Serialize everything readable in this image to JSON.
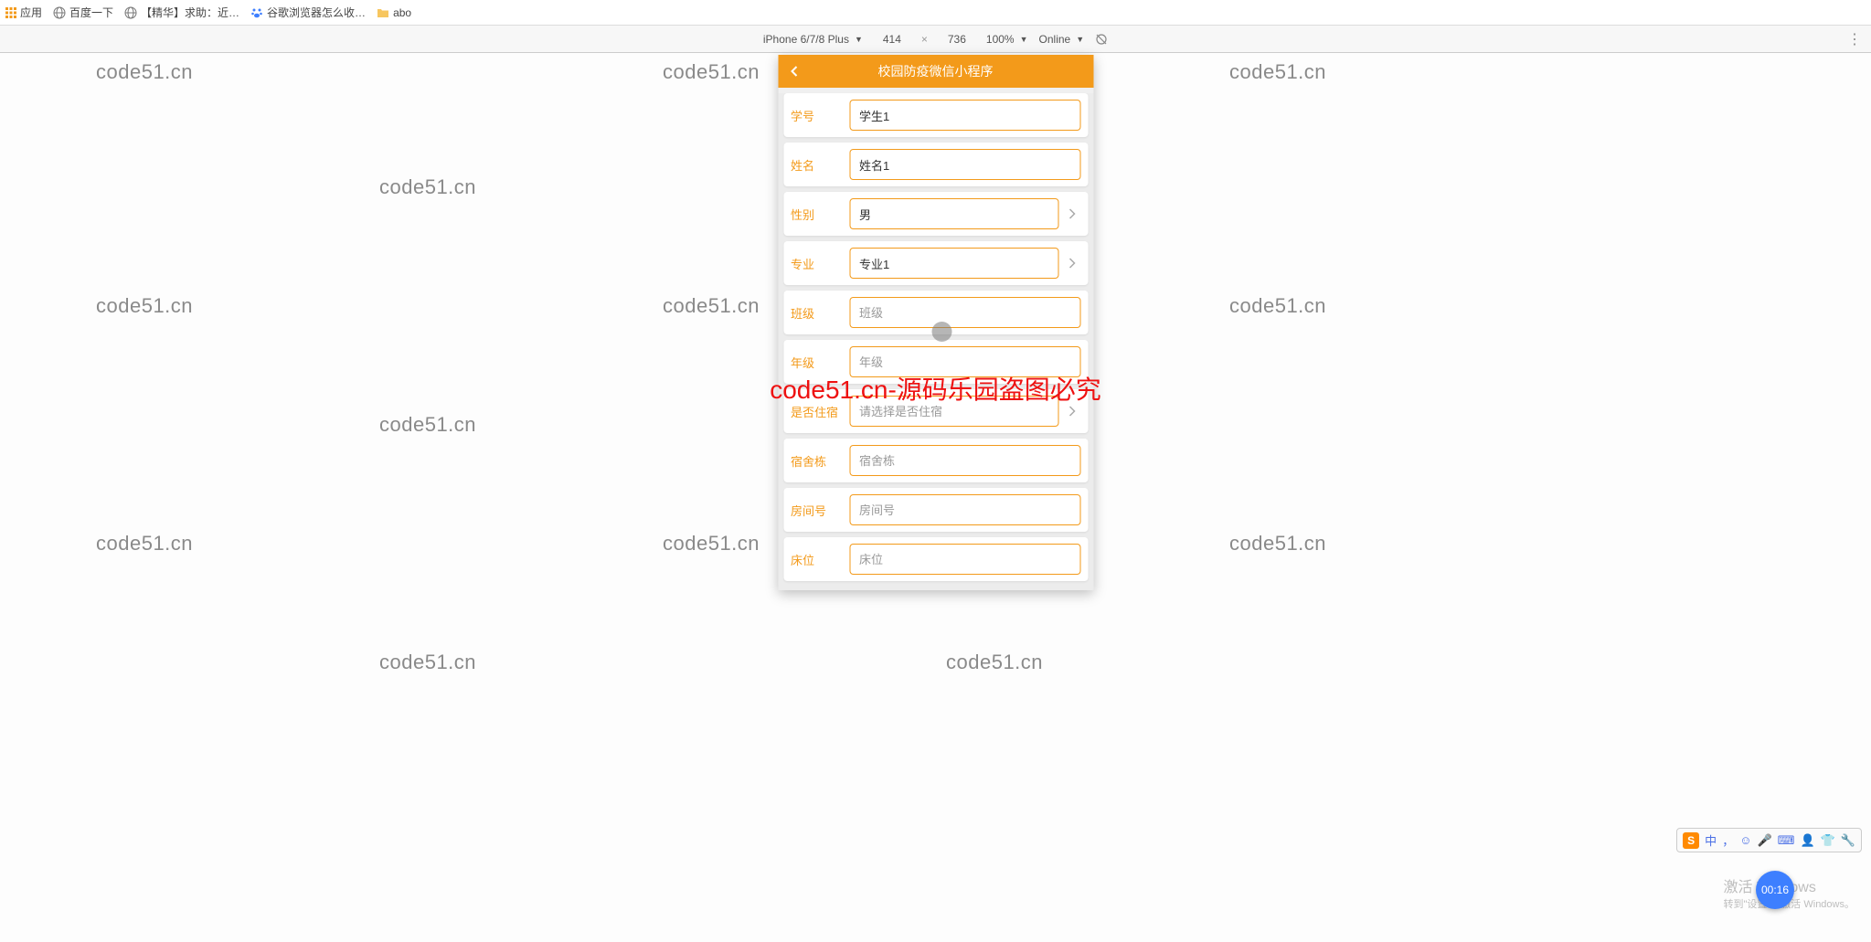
{
  "bookmarks": {
    "apps": "应用",
    "baidu": "百度一下",
    "jinghua": "【精华】求助：近…",
    "google_ext": "谷歌浏览器怎么收…",
    "abo": "abo"
  },
  "device_toolbar": {
    "device": "iPhone 6/7/8 Plus",
    "width": "414",
    "height": "736",
    "zoom": "100%",
    "online": "Online"
  },
  "app": {
    "title": "校园防疫微信小程序"
  },
  "form": {
    "fields": [
      {
        "label": "学号",
        "value": "学生1",
        "placeholder": "",
        "chevron": false
      },
      {
        "label": "姓名",
        "value": "姓名1",
        "placeholder": "",
        "chevron": false
      },
      {
        "label": "性别",
        "value": "男",
        "placeholder": "",
        "chevron": true
      },
      {
        "label": "专业",
        "value": "专业1",
        "placeholder": "",
        "chevron": true
      },
      {
        "label": "班级",
        "value": "",
        "placeholder": "班级",
        "chevron": false
      },
      {
        "label": "年级",
        "value": "",
        "placeholder": "年级",
        "chevron": false
      },
      {
        "label": "是否住宿",
        "value": "",
        "placeholder": "请选择是否住宿",
        "chevron": true
      },
      {
        "label": "宿舍栋",
        "value": "",
        "placeholder": "宿舍栋",
        "chevron": false
      },
      {
        "label": "房间号",
        "value": "",
        "placeholder": "房间号",
        "chevron": false
      },
      {
        "label": "床位",
        "value": "",
        "placeholder": "床位",
        "chevron": false
      }
    ]
  },
  "watermark_text": "code51.cn",
  "red_watermark": "code51.cn-源码乐园盗图必究",
  "ime": {
    "cn": "中"
  },
  "activation": {
    "line1": "激活 Windows",
    "line2": "转到\"设置\"以激活 Windows。"
  },
  "video_time": "00:16"
}
